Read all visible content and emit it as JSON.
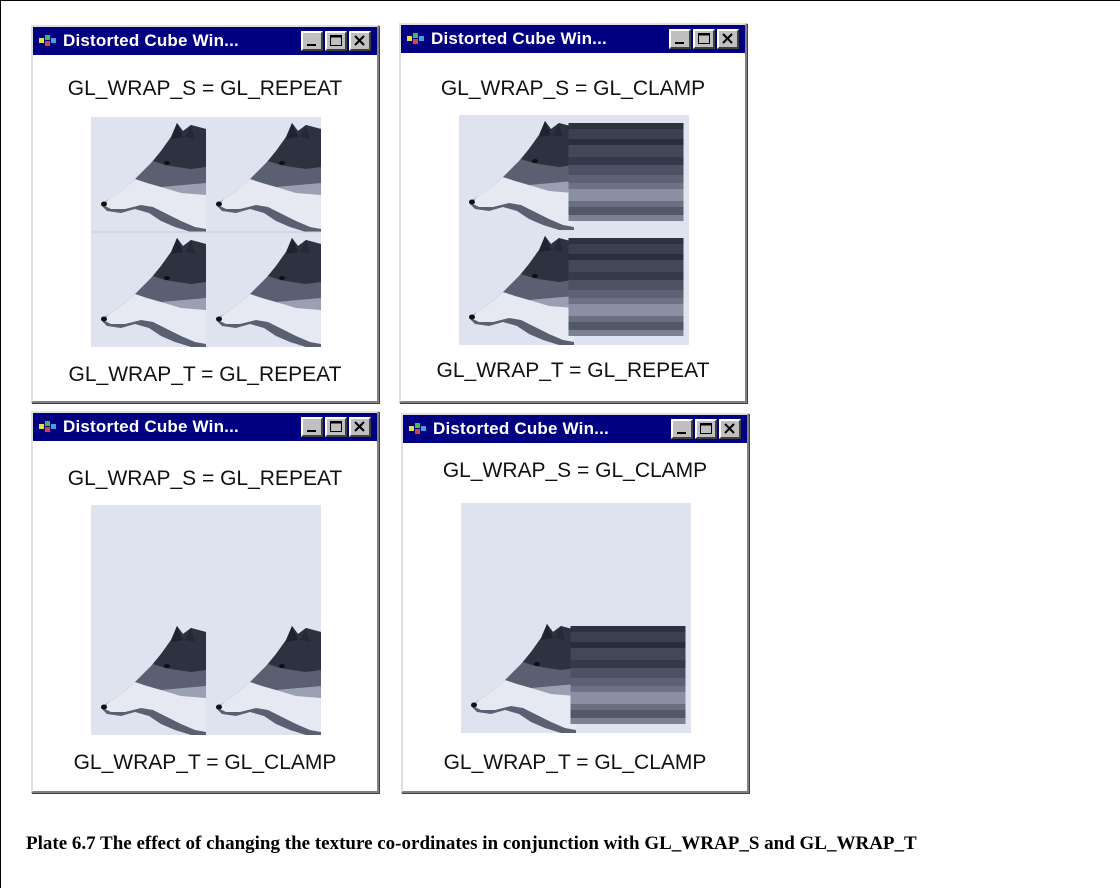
{
  "windows": [
    {
      "title": "Distorted Cube Win...",
      "wrap_s": "GL_WRAP_S = GL_REPEAT",
      "wrap_t": "GL_WRAP_T =  GL_REPEAT"
    },
    {
      "title": "Distorted Cube Win...",
      "wrap_s": "GL_WRAP_S = GL_CLAMP",
      "wrap_t": "GL_WRAP_T =  GL_REPEAT"
    },
    {
      "title": "Distorted Cube Win...",
      "wrap_s": "GL_WRAP_S = GL_REPEAT",
      "wrap_t": "GL_WRAP_T =  GL_CLAMP"
    },
    {
      "title": "Distorted Cube Win...",
      "wrap_s": "GL_WRAP_S = GL_CLAMP",
      "wrap_t": "GL_WRAP_T = GL_CLAMP"
    }
  ],
  "caption": "Plate 6.7 The effect of changing the texture co-ordinates in conjunction with GL_WRAP_S and GL_WRAP_T",
  "colors": {
    "titlebar": "#000080",
    "button_face": "#c0c0c0",
    "texture_bg": "#dfe3ef",
    "wolf_dark": "#3a3f4e",
    "wolf_light": "#eef0f6"
  },
  "icons": [
    "app-icon",
    "minimize-icon",
    "maximize-icon",
    "close-icon",
    "wolf-texture"
  ]
}
